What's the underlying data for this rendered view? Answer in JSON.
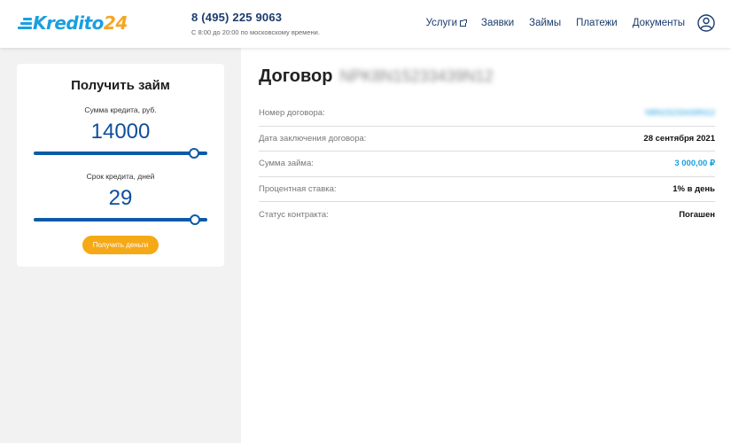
{
  "header": {
    "logo": {
      "main": "Kredito",
      "num": "24",
      "accent": "#1a9fe0",
      "num_color": "#f5a623"
    },
    "phone": "8 (495) 225 9063",
    "hours": "С 8:00 до 20:00 по московскому времени.",
    "nav": [
      {
        "label": "Услуги",
        "external": true
      },
      {
        "label": "Заявки"
      },
      {
        "label": "Займы"
      },
      {
        "label": "Платежи"
      },
      {
        "label": "Документы"
      }
    ],
    "user_icon": "user-circle-icon"
  },
  "loan_form": {
    "title": "Получить займ",
    "amount_label": "Сумма кредита, руб.",
    "amount_value": "14000",
    "amount_slider_fraction": 1.0,
    "term_label": "Срок кредита, дней",
    "term_value": "29",
    "term_slider_fraction": 1.0,
    "button_label": "Получить деньги",
    "accent": "#0d5aa7",
    "button_color": "#f6a916"
  },
  "contract": {
    "title": "Договор",
    "number_blurred": "NPK8N15233439N12",
    "rows": [
      {
        "label": "Номер договора:",
        "value": "N8N15233439N12",
        "style": "blurred"
      },
      {
        "label": "Дата заключения договора:",
        "value": "28 сентября 2021",
        "style": "bold"
      },
      {
        "label": "Сумма займа:",
        "value": "3 000,00 ₽",
        "style": "blue"
      },
      {
        "label": "Процентная ставка:",
        "value": "1% в день",
        "style": "bold"
      },
      {
        "label": "Статус контракта:",
        "value": "Погашен",
        "style": "bold"
      }
    ]
  }
}
